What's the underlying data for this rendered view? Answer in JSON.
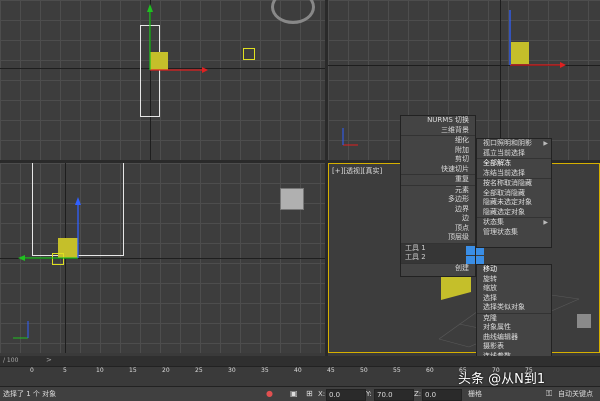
{
  "viewports": {
    "perspective_label": "[+][透视][真实]"
  },
  "menu_left": {
    "items": [
      {
        "label": "NURMS 切换",
        "sep": false
      },
      {
        "label": "三维背景",
        "sep": false
      },
      {
        "label": "细化",
        "sep": true
      },
      {
        "label": "附加",
        "sep": false
      },
      {
        "label": "剪切",
        "sep": false
      },
      {
        "label": "快速切片",
        "sep": false
      },
      {
        "label": "重复",
        "sep": true
      },
      {
        "label": "元素",
        "sep": true
      },
      {
        "label": "多边形",
        "sep": false
      },
      {
        "label": "边界",
        "sep": false
      },
      {
        "label": "边",
        "sep": false
      },
      {
        "label": "顶点",
        "sep": false
      },
      {
        "label": "顶层级",
        "sep": false
      }
    ],
    "tools1": "工具 1",
    "tools2": "工具 2",
    "create": "创建"
  },
  "menu_right": {
    "items": [
      {
        "label": "视口照明和阴影",
        "hl": false,
        "sep": false,
        "arrow": true
      },
      {
        "label": "孤立当前选择",
        "hl": false,
        "sep": false,
        "arrow": false
      },
      {
        "label": "全部解冻",
        "hl": true,
        "sep": true,
        "arrow": false
      },
      {
        "label": "冻结当前选择",
        "hl": false,
        "sep": false,
        "arrow": false
      },
      {
        "label": "按名称取消隐藏",
        "hl": false,
        "sep": true,
        "arrow": false
      },
      {
        "label": "全部取消隐藏",
        "hl": false,
        "sep": false,
        "arrow": false
      },
      {
        "label": "隐藏未选定对象",
        "hl": false,
        "sep": false,
        "arrow": false
      },
      {
        "label": "隐藏选定对象",
        "hl": false,
        "sep": false,
        "arrow": false
      },
      {
        "label": "状态集",
        "hl": false,
        "sep": true,
        "arrow": true
      },
      {
        "label": "管理状态集",
        "hl": false,
        "sep": false,
        "arrow": false
      }
    ],
    "transform_items": [
      {
        "label": "移动",
        "hl": true
      },
      {
        "label": "旋转",
        "hl": false
      },
      {
        "label": "缩放",
        "hl": false
      },
      {
        "label": "选择",
        "hl": false
      },
      {
        "label": "选择类似对象",
        "hl": false
      },
      {
        "label": "克隆",
        "hl": false
      },
      {
        "label": "对象属性",
        "hl": false
      },
      {
        "label": "曲线编辑器",
        "hl": false
      },
      {
        "label": "摄影表",
        "hl": false
      },
      {
        "label": "连线参数",
        "hl": false
      },
      {
        "label": "转换为",
        "hl": false
      }
    ]
  },
  "timeline": {
    "frame_readout": "/ 100"
  },
  "ruler": {
    "ticks": [
      "0",
      "5",
      "10",
      "15",
      "20",
      "25",
      "30",
      "35",
      "40",
      "45",
      "50",
      "55",
      "60",
      "65",
      "70",
      "75"
    ]
  },
  "status": {
    "selection_text": "选择了 1 个 对象",
    "x_label": "X:",
    "x_value": "0.0",
    "y_label": "Y:",
    "y_value": "70.0",
    "z_label": "Z:",
    "z_value": "0.0",
    "grid_label": "栅格",
    "autokey": "自动关键点"
  },
  "watermark": {
    "text": "头条 @从N到1"
  },
  "colors": {
    "accent_blue": "#3a8ee6",
    "gizmo_yellow": "#d6d31a",
    "axis_red": "#e02020",
    "axis_green": "#20c020",
    "axis_blue": "#3060ff"
  }
}
